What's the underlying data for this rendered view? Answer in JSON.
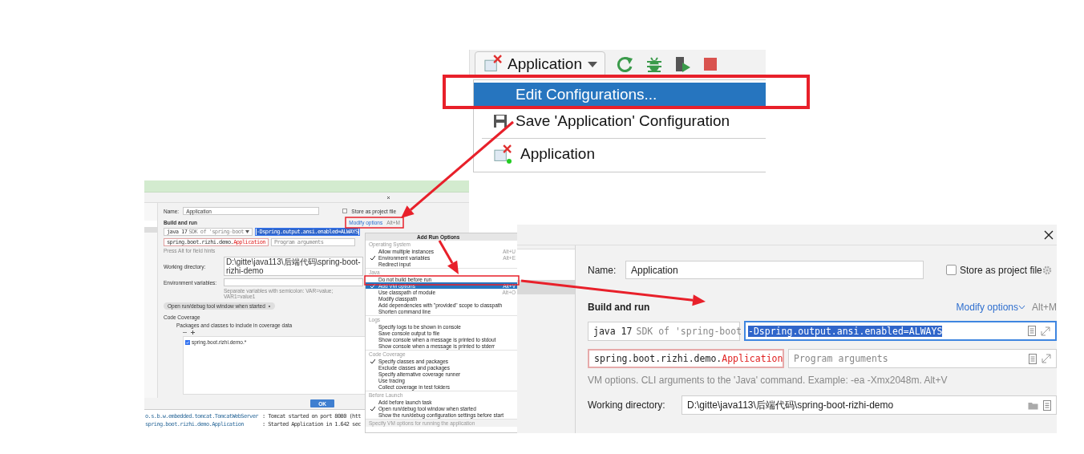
{
  "run_toolbar": {
    "config_name": "Application",
    "menu": [
      {
        "kind": "edit",
        "label": "Edit Configurations...",
        "selected": true
      },
      {
        "kind": "save",
        "label": "Save 'Application' Configuration",
        "selected": false
      },
      {
        "kind": "config",
        "label": "Application",
        "selected": false
      }
    ]
  },
  "small_dialog": {
    "name_label": "Name:",
    "name_value": "Application",
    "store_label": "Store as project file",
    "store_checked": false,
    "section": "Build and run",
    "modify_options": "Modify options",
    "modify_shortcut": "Alt+M",
    "jdk": "java 17",
    "jdk_hint": "SDK of 'spring-boot",
    "vm_options": "-Dspring.output.ansi.enabled=ALWAYS",
    "main_class_package": "spring.boot.rizhi.demo.",
    "main_class_name": "Application",
    "program_args_placeholder": "Program arguments",
    "hint": "Press Alt for field hints",
    "working_dir_label": "Working directory:",
    "working_dir": "D:\\gitte\\java113\\后端代码\\spring-boot-rizhi-demo",
    "env_label": "Environment variables:",
    "env_hint": "Separate variables with semicolon: VAR=value; VAR1=value1",
    "chip": "Open run/debug tool window when started",
    "coverage_title": "Code Coverage",
    "coverage_sub": "Packages and classes to include in coverage data",
    "coverage_items": [
      {
        "label": "spring.boot.rizhi.demo.*",
        "checked": true
      }
    ],
    "ok": "OK",
    "console": [
      {
        "logger": "o.s.b.w.embedded.tomcat.TomcatWebServer",
        "message": ": Tomcat started on port 8080 (htt"
      },
      {
        "logger": "spring.boot.rizhi.demo.Application",
        "message": ": Started Application in 1.642 sec"
      }
    ]
  },
  "add_run_options_popup": {
    "title": "Add Run Options",
    "groups": [
      {
        "title": "Operating System",
        "items": [
          {
            "label": "Allow multiple instances",
            "shortcut": "Alt+U",
            "checked": false,
            "selected": false
          },
          {
            "label": "Environment variables",
            "shortcut": "Alt+E",
            "checked": true,
            "selected": false
          },
          {
            "label": "Redirect input",
            "checked": false,
            "selected": false
          }
        ]
      },
      {
        "title": "Java",
        "items": [
          {
            "label": "Do not build before run",
            "checked": false,
            "selected": false
          },
          {
            "label": "Add VM options",
            "shortcut": "Alt+V",
            "checked": true,
            "selected": true
          },
          {
            "label": "Use classpath of module",
            "shortcut": "Alt+O",
            "checked": false,
            "selected": false
          },
          {
            "label": "Modify classpath",
            "checked": false,
            "selected": false
          },
          {
            "label": "Add dependencies with \"provided\" scope to classpath",
            "checked": false,
            "selected": false
          },
          {
            "label": "Shorten command line",
            "checked": false,
            "selected": false
          }
        ]
      },
      {
        "title": "Logs",
        "items": [
          {
            "label": "Specify logs to be shown in console",
            "checked": false,
            "selected": false
          },
          {
            "label": "Save console output to file",
            "checked": false,
            "selected": false
          },
          {
            "label": "Show console when a message is printed to stdout",
            "checked": false,
            "selected": false
          },
          {
            "label": "Show console when a message is printed to stderr",
            "checked": false,
            "selected": false
          }
        ]
      },
      {
        "title": "Code Coverage",
        "items": [
          {
            "label": "Specify classes and packages",
            "checked": true,
            "selected": false
          },
          {
            "label": "Exclude classes and packages",
            "checked": false,
            "selected": false
          },
          {
            "label": "Specify alternative coverage runner",
            "checked": false,
            "selected": false
          },
          {
            "label": "Use tracing",
            "checked": false,
            "selected": false
          },
          {
            "label": "Collect coverage in test folders",
            "checked": false,
            "selected": false
          }
        ]
      },
      {
        "title": "Before Launch",
        "items": [
          {
            "label": "Add before launch task",
            "checked": false,
            "selected": false
          },
          {
            "label": "Open run/debug tool window when started",
            "checked": true,
            "selected": false
          },
          {
            "label": "Show the run/debug configuration settings before start",
            "checked": false,
            "selected": false
          }
        ]
      }
    ],
    "footer": "Specify VM options for running the application"
  },
  "large_dialog": {
    "name_label": "Name:",
    "name_value": "Application",
    "store_label": "Store as project file",
    "store_checked": false,
    "section": "Build and run",
    "modify_options": "Modify options",
    "modify_shortcut": "Alt+M",
    "jdk": "java 17",
    "jdk_hint": "SDK of 'spring-boot",
    "vm_options": "-Dspring.output.ansi.enabled=ALWAYS",
    "main_class_package": "spring.boot.rizhi.demo.",
    "main_class_name": "Application",
    "program_args_placeholder": "Program arguments",
    "hint": "VM options. CLI arguments to the 'Java' command. Example: -ea -Xmx2048m. Alt+V",
    "working_dir_label": "Working directory:",
    "working_dir": "D:\\gitte\\java113\\后端代码\\spring-boot-rizhi-demo"
  }
}
